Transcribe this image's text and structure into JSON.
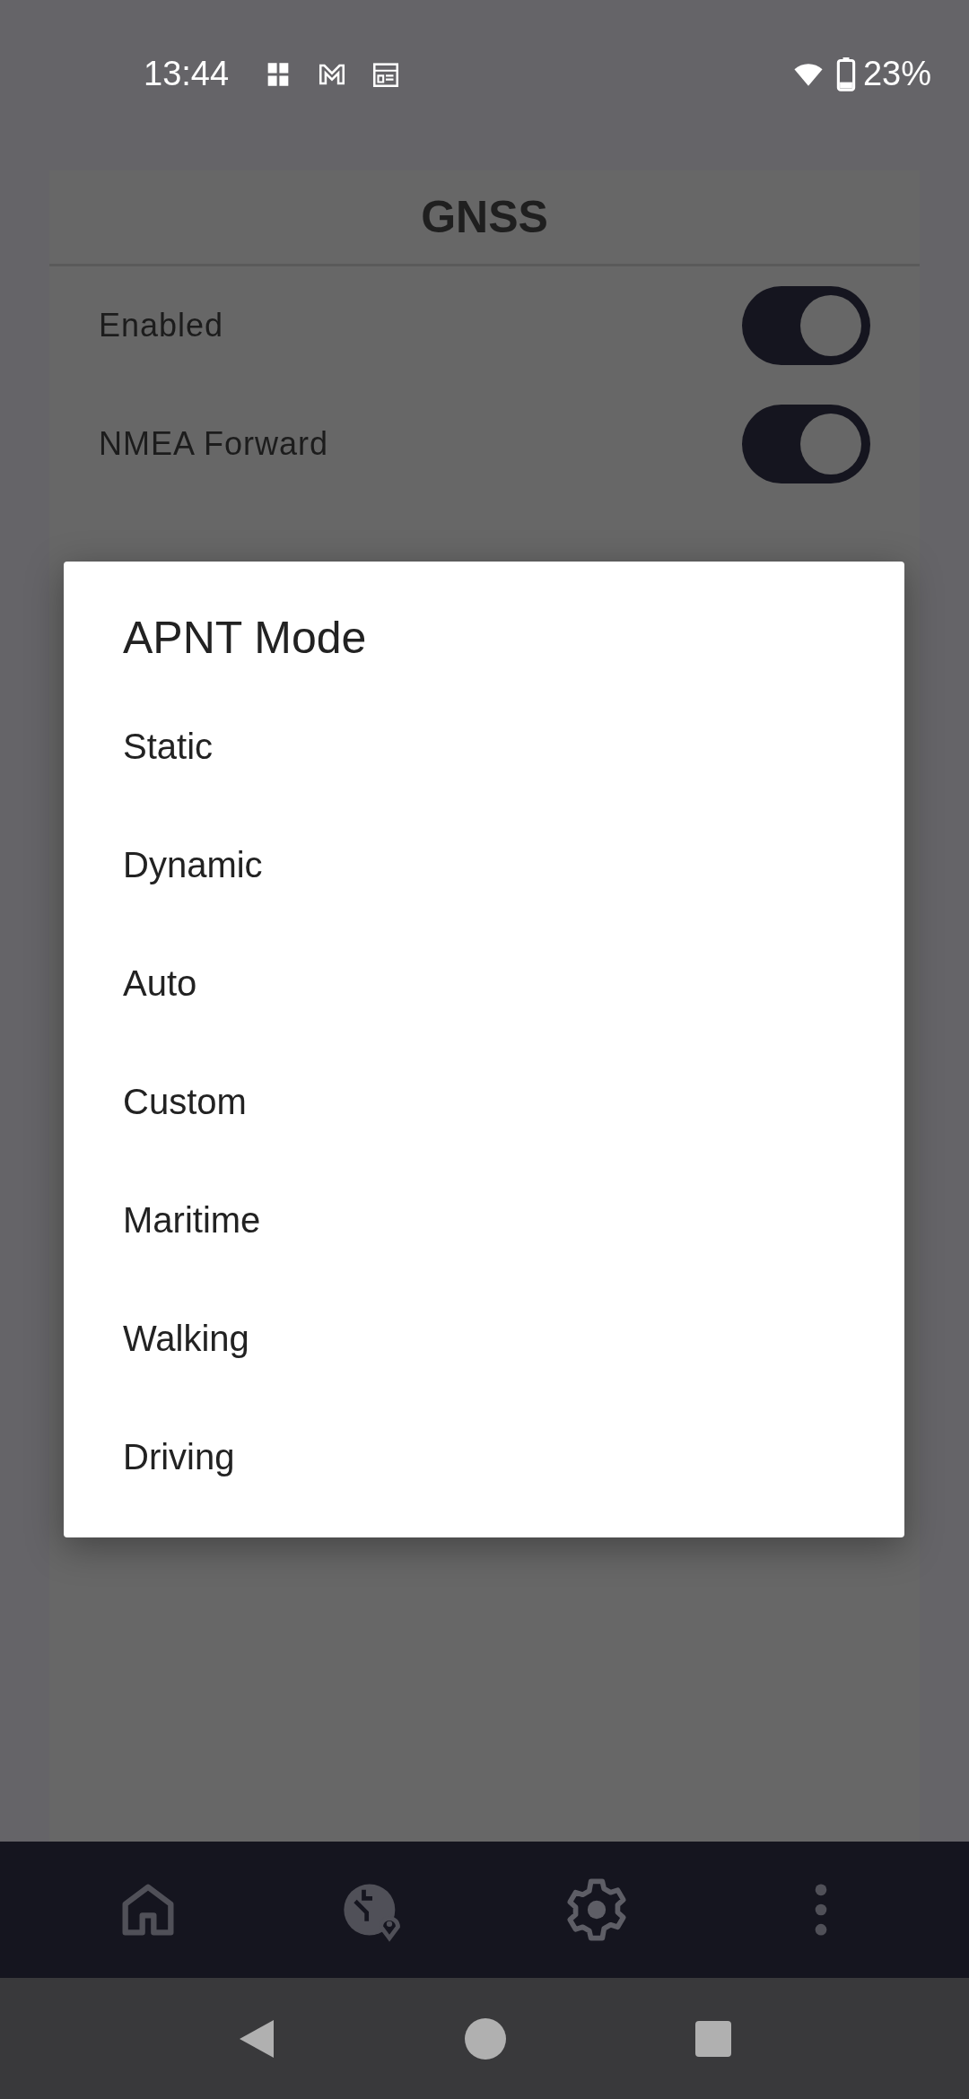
{
  "status_bar": {
    "time": "13:44",
    "battery": "23%"
  },
  "card": {
    "title": "GNSS",
    "rows": [
      {
        "kind": "toggle",
        "label": "Enabled",
        "on": true
      },
      {
        "kind": "toggle",
        "label": "NMEA Forward",
        "on": true
      }
    ]
  },
  "dialog": {
    "title": "APNT Mode",
    "options": [
      "Static",
      "Dynamic",
      "Auto",
      "Custom",
      "Maritime",
      "Walking",
      "Driving"
    ]
  }
}
